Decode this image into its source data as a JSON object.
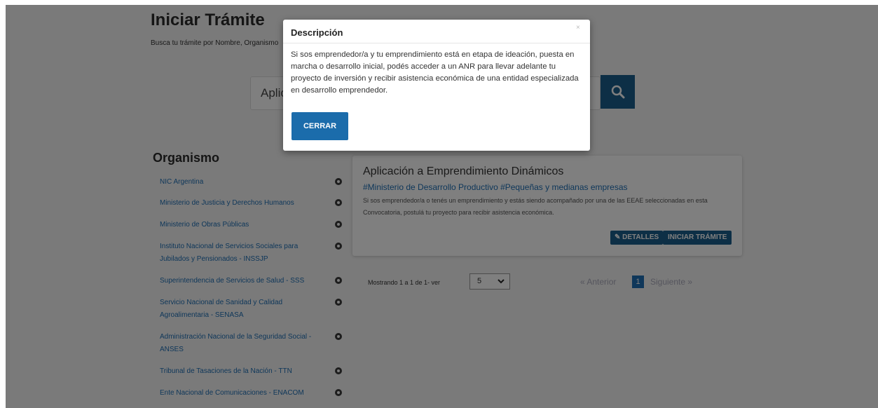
{
  "header": {
    "title": "Iniciar Trámite",
    "subtitle": "Busca tu trámite por Nombre, Organismo"
  },
  "search": {
    "value": "Aplic",
    "button_icon": "search-icon"
  },
  "organismo": {
    "title": "Organismo",
    "items": [
      "NIC Argentina",
      "Ministerio de Justicia y Derechos Humanos",
      "Ministerio de Obras Públicas",
      "Instituto Nacional de Servicios Sociales para Jubilados y Pensionados - INSSJP",
      "Superintendencia de Servicios de Salud - SSS",
      "Servicio Nacional de Sanidad y Calidad Agroalimentaria - SENASA",
      "Administración Nacional de la Seguridad Social - ANSES",
      "Tribunal de Tasaciones de la Nación - TTN",
      "Ente Nacional de Comunicaciones - ENACOM"
    ]
  },
  "result": {
    "title": "Aplicación a Emprendimiento Dinámicos",
    "tags": "#Ministerio de Desarrollo Productivo #Pequeñas y medianas empresas",
    "description": "Si sos emprendedor/a o tenés un emprendimiento y estás siendo acompañado por una de las EEAE seleccionadas en esta Convocatoria, postulá tu proyecto para recibir asistencia económica.",
    "details_label": "✎ DETALLES",
    "start_label": "INICIAR TRÁMITE"
  },
  "pagination": {
    "showing": "Mostrando 1 a 1 de 1- ver",
    "page_size": "5",
    "prev": "« Anterior",
    "page": "1",
    "next": "Siguiente »"
  },
  "modal": {
    "title": "Descripción",
    "close": "×",
    "body": "Si sos emprendedor/a y tu emprendimiento está en etapa de ideación, puesta en marcha o desarrollo inicial, podés acceder a un ANR para llevar adelante tu proyecto de inversión y recibir asistencia económica de una entidad especializada en desarrollo emprendedor.",
    "button": "CERRAR"
  },
  "colors": {
    "primary": "#1b5e8c",
    "link": "#1e6fb5",
    "overlay": "rgba(0,0,0,0.5)"
  }
}
